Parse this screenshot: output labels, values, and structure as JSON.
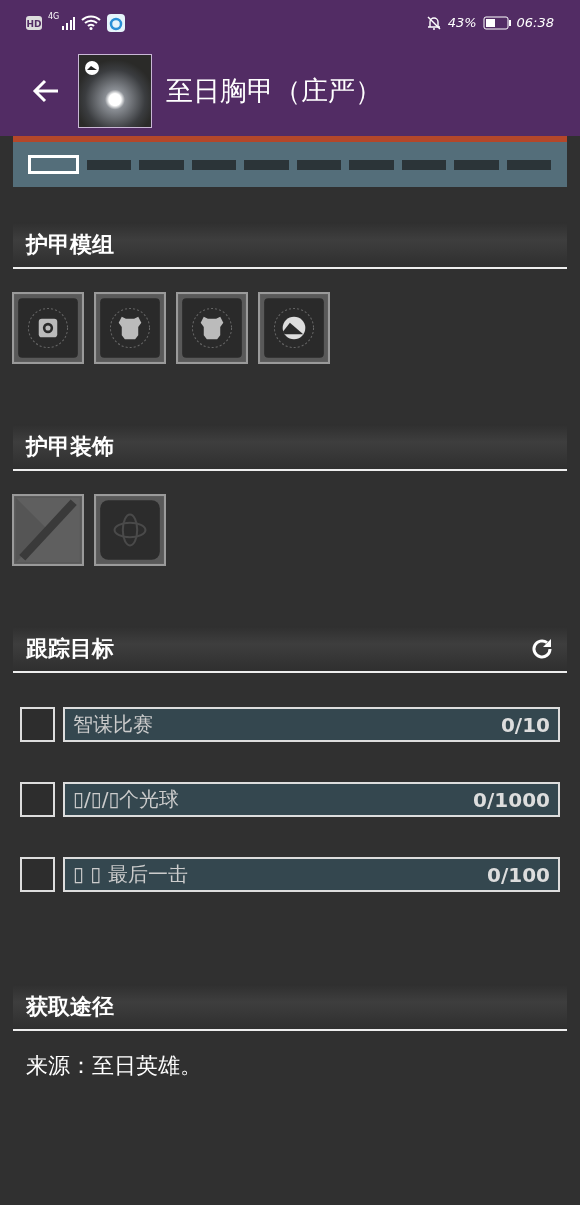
{
  "status_bar": {
    "hd": "HD",
    "network": "4G",
    "battery": "43%",
    "time": "06:38"
  },
  "header": {
    "title": "至日胸甲（庄严）"
  },
  "tiers": [
    {
      "selected": true
    },
    {
      "selected": false
    },
    {
      "selected": false
    },
    {
      "selected": false
    },
    {
      "selected": false
    },
    {
      "selected": false
    },
    {
      "selected": false
    },
    {
      "selected": false
    },
    {
      "selected": false
    },
    {
      "selected": false
    }
  ],
  "armor_mods": {
    "title": "护甲模组",
    "slots": [
      {
        "kind": "gear"
      },
      {
        "kind": "vest"
      },
      {
        "kind": "vest"
      },
      {
        "kind": "peak"
      }
    ]
  },
  "ornaments": {
    "title": "护甲装饰",
    "slots": [
      {
        "kind": "default"
      },
      {
        "kind": "pattern"
      }
    ]
  },
  "tracking": {
    "title": "跟踪目标",
    "objectives": [
      {
        "label": "智谋比赛",
        "progress": "0/10",
        "checked": false,
        "level": 0
      },
      {
        "label": "▯/▯/▯个光球",
        "progress": "0/1000",
        "checked": false,
        "level": 0
      },
      {
        "label": "▯ ▯ 最后一击",
        "progress": "0/100",
        "checked": false,
        "level": 0
      }
    ]
  },
  "acquisition": {
    "title": "获取途径",
    "text": "来源：至日英雄。"
  }
}
